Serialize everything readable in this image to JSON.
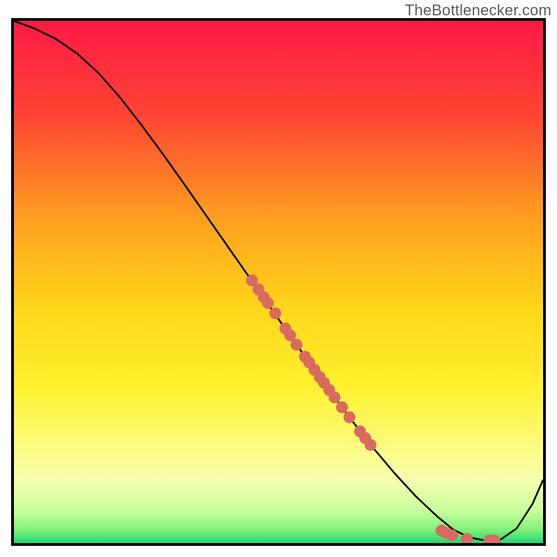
{
  "watermark": "TheBottlenecker.com",
  "chart_data": {
    "type": "line",
    "title": "",
    "xlabel": "",
    "ylabel": "",
    "xlim": [
      0,
      100
    ],
    "ylim": [
      0,
      100
    ],
    "grid": false,
    "legend": false,
    "background_gradient": {
      "stops": [
        {
          "offset": 0.0,
          "color": "#ff1a44"
        },
        {
          "offset": 0.18,
          "color": "#ff4433"
        },
        {
          "offset": 0.38,
          "color": "#ffa020"
        },
        {
          "offset": 0.55,
          "color": "#ffd61a"
        },
        {
          "offset": 0.7,
          "color": "#fff12e"
        },
        {
          "offset": 0.8,
          "color": "#fffa74"
        },
        {
          "offset": 0.88,
          "color": "#f5ffb0"
        },
        {
          "offset": 0.94,
          "color": "#c6ff99"
        },
        {
          "offset": 0.975,
          "color": "#7ff07a"
        },
        {
          "offset": 1.0,
          "color": "#1fd872"
        }
      ]
    },
    "series": [
      {
        "name": "bottleneck-curve",
        "color": "#000000",
        "stroke_width": 2.5,
        "x": [
          0,
          4,
          8,
          12,
          16,
          20,
          24,
          28,
          32,
          36,
          40,
          44,
          48,
          52,
          56,
          60,
          64,
          68,
          72,
          76,
          80,
          83,
          86,
          89,
          92,
          95,
          98,
          100
        ],
        "y": [
          100,
          98.5,
          96.5,
          93.7,
          90.0,
          85.4,
          80.2,
          74.7,
          69.0,
          63.2,
          57.4,
          51.6,
          45.8,
          40.0,
          34.3,
          28.7,
          23.3,
          18.1,
          13.3,
          8.9,
          5.1,
          2.6,
          1.1,
          0.5,
          0.7,
          2.8,
          7.5,
          12.1
        ]
      }
    ],
    "scatter": {
      "name": "marked-points",
      "color": "#d86a60",
      "radius": 8.5,
      "points": [
        {
          "x": 45.0,
          "y": 50.3
        },
        {
          "x": 46.2,
          "y": 48.6
        },
        {
          "x": 47.2,
          "y": 47.1
        },
        {
          "x": 48.0,
          "y": 46.0
        },
        {
          "x": 49.4,
          "y": 44.0
        },
        {
          "x": 51.3,
          "y": 41.1
        },
        {
          "x": 52.2,
          "y": 39.8
        },
        {
          "x": 53.4,
          "y": 38.0
        },
        {
          "x": 55.0,
          "y": 35.7
        },
        {
          "x": 55.8,
          "y": 34.6
        },
        {
          "x": 56.8,
          "y": 33.2
        },
        {
          "x": 57.8,
          "y": 31.8
        },
        {
          "x": 58.6,
          "y": 30.7
        },
        {
          "x": 59.6,
          "y": 29.3
        },
        {
          "x": 60.6,
          "y": 27.9
        },
        {
          "x": 62.0,
          "y": 26.0
        },
        {
          "x": 63.4,
          "y": 24.1
        },
        {
          "x": 65.4,
          "y": 21.4
        },
        {
          "x": 66.4,
          "y": 20.1
        },
        {
          "x": 67.4,
          "y": 18.8
        },
        {
          "x": 80.8,
          "y": 2.4
        },
        {
          "x": 81.8,
          "y": 1.9
        },
        {
          "x": 82.8,
          "y": 1.5
        },
        {
          "x": 85.6,
          "y": 0.8
        },
        {
          "x": 89.8,
          "y": 0.5
        },
        {
          "x": 90.8,
          "y": 0.5
        }
      ]
    }
  }
}
